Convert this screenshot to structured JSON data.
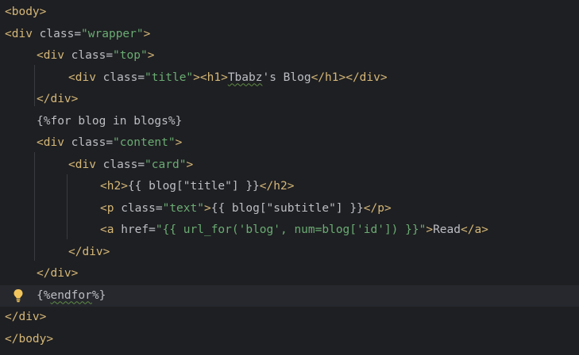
{
  "editor": {
    "lines": [
      {
        "indent": 0,
        "tokens": [
          {
            "t": "tag",
            "v": "<body>"
          }
        ]
      },
      {
        "indent": 0,
        "tokens": [
          {
            "t": "tag",
            "v": "<div "
          },
          {
            "t": "attr",
            "v": "class"
          },
          {
            "t": "eq",
            "v": "="
          },
          {
            "t": "str",
            "v": "\"wrapper\""
          },
          {
            "t": "tag",
            "v": ">"
          }
        ]
      },
      {
        "indent": 1,
        "tokens": [
          {
            "t": "tag",
            "v": "<div "
          },
          {
            "t": "attr",
            "v": "class"
          },
          {
            "t": "eq",
            "v": "="
          },
          {
            "t": "str",
            "v": "\"top\""
          },
          {
            "t": "tag",
            "v": ">"
          }
        ]
      },
      {
        "indent": 2,
        "tokens": [
          {
            "t": "tag",
            "v": "<div "
          },
          {
            "t": "attr",
            "v": "class"
          },
          {
            "t": "eq",
            "v": "="
          },
          {
            "t": "str",
            "v": "\"title\""
          },
          {
            "t": "tag",
            "v": "><h1>"
          },
          {
            "t": "txt",
            "v": "Tbabz",
            "squiggle": true
          },
          {
            "t": "txt",
            "v": "'s Blog"
          },
          {
            "t": "tag",
            "v": "</h1></div>"
          }
        ]
      },
      {
        "indent": 1,
        "tokens": [
          {
            "t": "tag",
            "v": "</div>"
          }
        ]
      },
      {
        "indent": 1,
        "tokens": [
          {
            "t": "txt",
            "v": "{%for blog in blogs%}"
          }
        ]
      },
      {
        "indent": 1,
        "tokens": [
          {
            "t": "tag",
            "v": "<div "
          },
          {
            "t": "attr",
            "v": "class"
          },
          {
            "t": "eq",
            "v": "="
          },
          {
            "t": "str",
            "v": "\"content\""
          },
          {
            "t": "tag",
            "v": ">"
          }
        ]
      },
      {
        "indent": 2,
        "tokens": [
          {
            "t": "tag",
            "v": "<div "
          },
          {
            "t": "attr",
            "v": "class"
          },
          {
            "t": "eq",
            "v": "="
          },
          {
            "t": "str",
            "v": "\"card\""
          },
          {
            "t": "tag",
            "v": ">"
          }
        ]
      },
      {
        "indent": 3,
        "tokens": [
          {
            "t": "tag",
            "v": "<h2>"
          },
          {
            "t": "txt",
            "v": "{{ blog[\"title\"] }}"
          },
          {
            "t": "tag",
            "v": "</h2>"
          }
        ]
      },
      {
        "indent": 3,
        "tokens": [
          {
            "t": "tag",
            "v": "<p "
          },
          {
            "t": "attr",
            "v": "class"
          },
          {
            "t": "eq",
            "v": "="
          },
          {
            "t": "str",
            "v": "\"text\""
          },
          {
            "t": "tag",
            "v": ">"
          },
          {
            "t": "txt",
            "v": "{{ blog[\"subtitle\"] }}"
          },
          {
            "t": "tag",
            "v": "</p>"
          }
        ]
      },
      {
        "indent": 3,
        "tokens": [
          {
            "t": "tag",
            "v": "<a "
          },
          {
            "t": "attr",
            "v": "href"
          },
          {
            "t": "eq",
            "v": "="
          },
          {
            "t": "str",
            "v": "\"{{ url_for('blog', num=blog['id']) }}\""
          },
          {
            "t": "tag",
            "v": ">"
          },
          {
            "t": "txt",
            "v": "Read"
          },
          {
            "t": "tag",
            "v": "</a>"
          }
        ]
      },
      {
        "indent": 2,
        "tokens": [
          {
            "t": "tag",
            "v": "</div>"
          }
        ]
      },
      {
        "indent": 1,
        "tokens": [
          {
            "t": "tag",
            "v": "</div>"
          }
        ]
      },
      {
        "indent": 1,
        "caret": true,
        "tokens": [
          {
            "t": "txt",
            "v": "{%"
          },
          {
            "t": "txt",
            "v": "endfor",
            "squiggle": true
          },
          {
            "t": "txt",
            "v": "%}"
          }
        ]
      },
      {
        "indent": 0,
        "tokens": [
          {
            "t": "tag",
            "v": "</div>"
          }
        ]
      },
      {
        "indent": 0,
        "tokens": [
          {
            "t": "tag",
            "v": "</body>"
          }
        ]
      }
    ]
  },
  "colors": {
    "background": "#1e1f22",
    "caret_line": "#26282e",
    "tag": "#d5b778",
    "string": "#6aab73",
    "text": "#bcbec4",
    "indent_guide": "#393b40",
    "bulb": "#f2c55c"
  },
  "icons": {
    "intention": "lightbulb-icon"
  }
}
